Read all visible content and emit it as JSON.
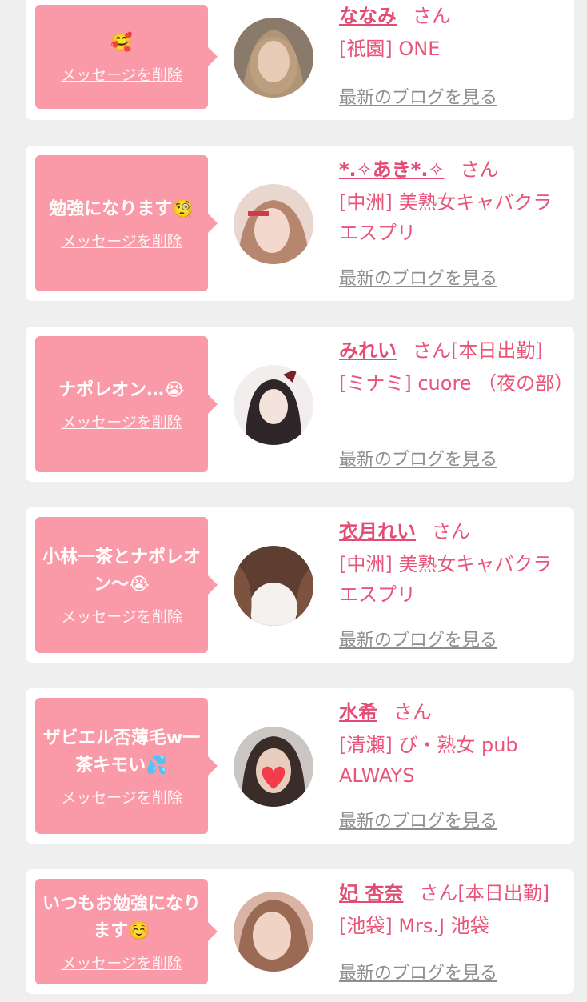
{
  "messages": [
    {
      "message": "🥰",
      "delete_label": "メッセージを削除",
      "name": "ななみ",
      "suffix": "さん",
      "shop": "[祇園] ONE",
      "blog_label": "最新のブログを見る",
      "avatar_color": "#7a6a5c"
    },
    {
      "message": "勉強になります🧐",
      "delete_label": "メッセージを削除",
      "name": "*.✧あき*.✧",
      "suffix": "さん",
      "shop": "[中洲] 美熟女キャバクラ エスプリ",
      "blog_label": "最新のブログを見る",
      "avatar_color": "#e9c7c2"
    },
    {
      "message": "ナポレオン…😭",
      "delete_label": "メッセージを削除",
      "name": "みれい",
      "suffix": "さん[本日出勤]",
      "shop": "[ミナミ] cuore （夜の部）",
      "blog_label": "最新のブログを見る",
      "avatar_color": "#3a3236"
    },
    {
      "message": "小林一茶とナポレオン〜😭",
      "delete_label": "メッセージを削除",
      "name": "衣月れい",
      "suffix": "さん",
      "shop": "[中洲] 美熟女キャバクラ エスプリ",
      "blog_label": "最新のブログを見る",
      "avatar_color": "#6b4a3a"
    },
    {
      "message": "ザビエル否薄毛w一茶キモい💦",
      "delete_label": "メッセージを削除",
      "name": "水希",
      "suffix": "さん",
      "shop": "[清瀬] び・熟女 pub ALWAYS",
      "blog_label": "最新のブログを見る",
      "avatar_color": "#8d8a88"
    },
    {
      "message": "いつもお勉強になります☺️",
      "delete_label": "メッセージを削除",
      "name": "妃 杏奈",
      "suffix": "さん[本日出勤]",
      "shop": "[池袋] Mrs.J 池袋",
      "blog_label": "最新のブログを見る",
      "avatar_color": "#c79a8a"
    }
  ]
}
